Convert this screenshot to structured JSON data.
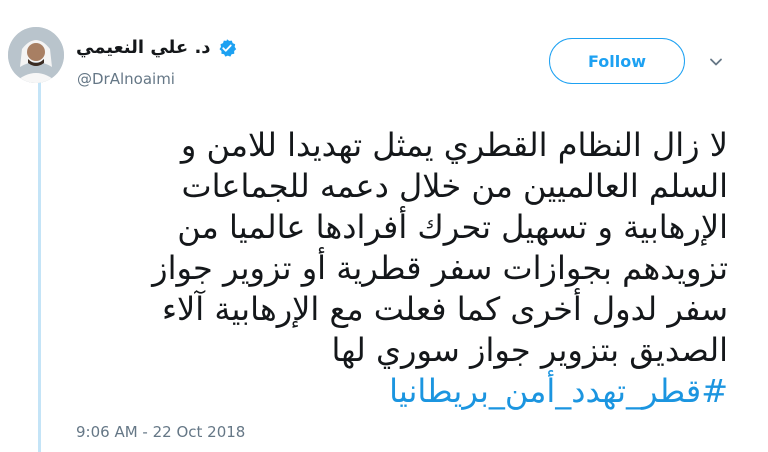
{
  "author": {
    "display_name": "د. علي النعيمي",
    "handle": "@DrAlnoaimi",
    "verified": true
  },
  "actions": {
    "follow_label": "Follow"
  },
  "tweet": {
    "lines": [
      "لا زال النظام القطري يمثل تهديدا للامن و",
      "السلم العالميين من خلال دعمه للجماعات",
      "الإرهابية و تسهيل تحرك أفرادها عالميا من",
      "تزويدهم بجوازات سفر قطرية أو تزوير جواز",
      "سفر لدول أخرى كما فعلت مع الإرهابية آلاء",
      "الصديق بتزوير جواز سوري لها"
    ],
    "hashtag": "#قطر_تهدد_أمن_بريطانيا",
    "timestamp": "9:06 AM - 22 Oct 2018"
  },
  "colors": {
    "accent": "#1da1f2",
    "hashtag": "#1b95e0",
    "secondary_text": "#657786",
    "thread_line": "#c4e4f7"
  },
  "icons": {
    "verified": "verified-badge-icon",
    "menu": "chevron-down-icon"
  }
}
